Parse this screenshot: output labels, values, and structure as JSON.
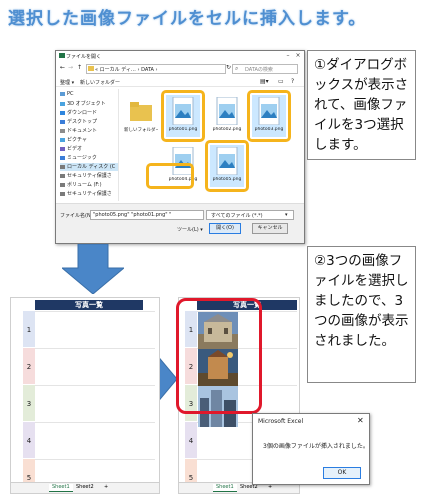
{
  "heading": "選択した画像ファイルをセルに挿入します。",
  "dialog": {
    "title": "ファイルを開く",
    "path": "« ローカル ディ… › DATA ›",
    "search_placeholder": "DATAの検索",
    "toolbar": {
      "organize": "整理 ▾",
      "new_folder": "新しいフォルダー"
    },
    "sidebar": [
      {
        "label": "PC",
        "icon": "pc-icon",
        "color": "#5b9bd5"
      },
      {
        "label": "3D オブジェクト",
        "icon": "cube-icon",
        "color": "#4aa3df"
      },
      {
        "label": "ダウンロード",
        "icon": "download-icon",
        "color": "#2e86de"
      },
      {
        "label": "デスクトップ",
        "icon": "desktop-icon",
        "color": "#3b7dd8"
      },
      {
        "label": "ドキュメント",
        "icon": "document-icon",
        "color": "#8c8c8c"
      },
      {
        "label": "ピクチャ",
        "icon": "picture-icon",
        "color": "#4aa3df"
      },
      {
        "label": "ビデオ",
        "icon": "video-icon",
        "color": "#6f5fbf"
      },
      {
        "label": "ミュージック",
        "icon": "music-icon",
        "color": "#3b7dd8"
      },
      {
        "label": "ローカル ディスク (C",
        "icon": "drive-icon",
        "color": "#7a7a7a"
      },
      {
        "label": "セキュリティ保護さ",
        "icon": "network-drive-icon",
        "color": "#7a7a7a"
      },
      {
        "label": "ボリューム (F:)",
        "icon": "drive-icon",
        "color": "#7a7a7a"
      },
      {
        "label": "セキュリティ保護さ",
        "icon": "network-drive-icon",
        "color": "#7a7a7a"
      }
    ],
    "selected_sidebar": "ローカル ディスク (C",
    "files": [
      {
        "name": "新しいフォルダー",
        "type": "folder",
        "selected": false
      },
      {
        "name": "photo01.png",
        "type": "image",
        "selected": true
      },
      {
        "name": "photo02.png",
        "type": "image",
        "selected": false
      },
      {
        "name": "photo03.png",
        "type": "image",
        "selected": true
      },
      {
        "name": "photo04.png",
        "type": "image",
        "selected": false
      },
      {
        "name": "photo05.png",
        "type": "image",
        "selected": true
      }
    ],
    "filename_label": "ファイル名(N):",
    "filename_value": "\"photo05.png\" \"photo01.png\" \"",
    "filetype_value": "すべてのファイル (*.*)",
    "tools_label": "ツール(L) ▾",
    "open_button": "開く(O)",
    "cancel_button": "キャンセル"
  },
  "note1": "①ダイアログボックスが表示されて、画像ファイルを3つ選択します。",
  "note2": "②3つの画像ファイルを選択しましたので、3つの画像が表示されました。",
  "sheet": {
    "header": "写真一覧",
    "rows": [
      "1",
      "2",
      "3",
      "4",
      "5"
    ],
    "row_colors": [
      "#dde4f3",
      "#f6dcdc",
      "#e3ecd9",
      "#e6e0f0",
      "#f9dfd3"
    ],
    "tabs": [
      "Sheet1",
      "Sheet2"
    ],
    "add_tab": "+"
  },
  "message": {
    "title": "Microsoft Excel",
    "close": "✕",
    "body": "3個の画像ファイルが挿入されました。",
    "ok": "OK"
  },
  "colors": {
    "highlight_ring": "#f5b41c",
    "red_ring": "#e0182b",
    "arrow": "#4a86c8",
    "header": "#1f3864"
  }
}
